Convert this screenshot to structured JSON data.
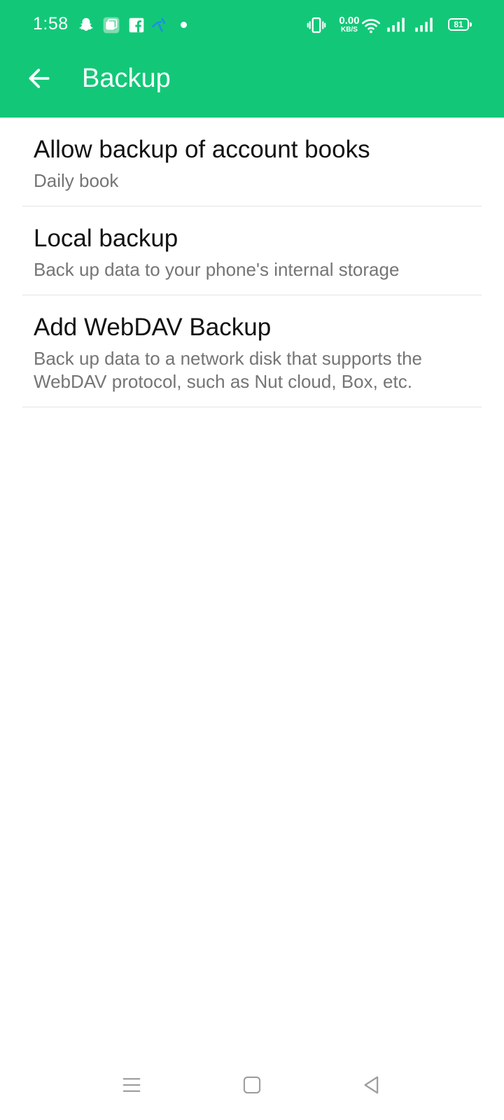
{
  "status_bar": {
    "time": "1:58",
    "net_speed_value": "0.00",
    "net_speed_unit": "KB/S",
    "battery_level": "81",
    "icons": [
      "snapchat-icon",
      "app-icon",
      "facebook-icon",
      "telenor-icon",
      "dot-icon",
      "vibrate-icon",
      "wifi-icon",
      "signal-icon",
      "signal-icon",
      "battery-icon"
    ]
  },
  "app_bar": {
    "title": "Backup",
    "back_icon": "back-arrow-icon"
  },
  "items": [
    {
      "title": "Allow backup of account books",
      "subtitle": "Daily book"
    },
    {
      "title": "Local backup",
      "subtitle": "Back up data to your phone's internal storage"
    },
    {
      "title": "Add WebDAV Backup",
      "subtitle": "Back up data to a network disk that supports the WebDAV protocol, such as Nut cloud, Box, etc."
    }
  ],
  "nav_bar": {
    "icons": [
      "menu-icon",
      "home-icon",
      "back-icon"
    ]
  },
  "colors": {
    "accent": "#12c878",
    "title_text": "#111111",
    "subtitle_text": "#757575",
    "divider": "#e4e4e4",
    "nav_icon": "#9e9e9e"
  }
}
